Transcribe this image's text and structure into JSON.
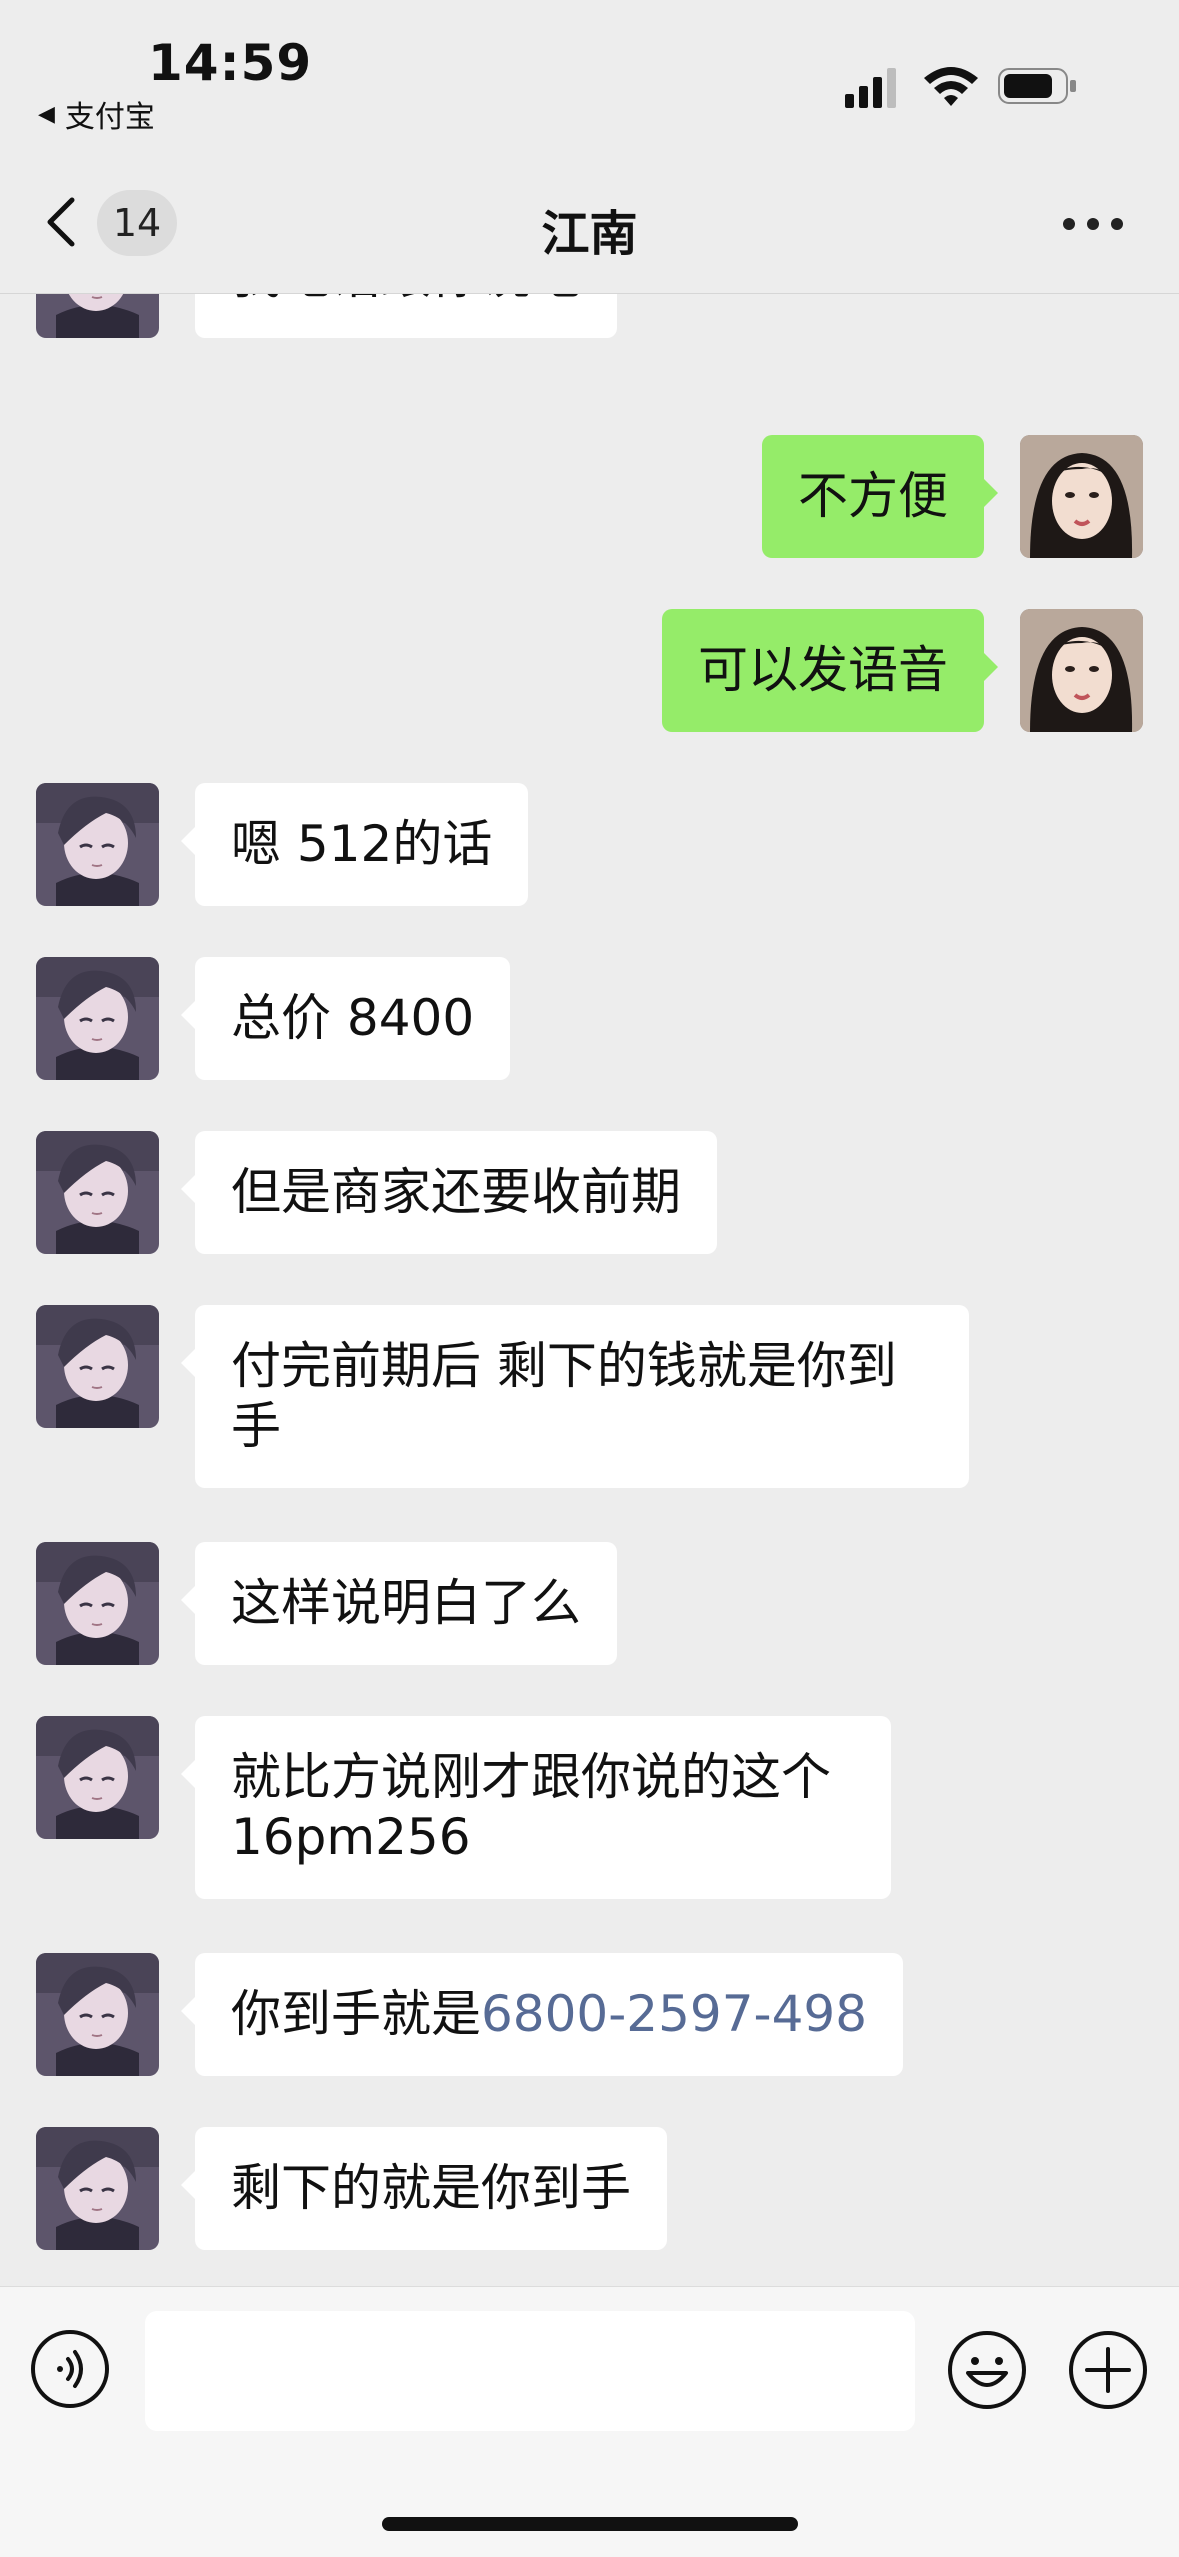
{
  "status_bar": {
    "time": "14:59",
    "back_app_label": "支付宝",
    "icons": [
      "cellular-signal-icon",
      "wifi-icon",
      "battery-icon"
    ]
  },
  "nav": {
    "title": "江南",
    "unread_count": "14",
    "icons": [
      "chevron-left-icon",
      "more-icon"
    ]
  },
  "messages": [
    {
      "side": "left",
      "text": "我电话跟你说吧"
    },
    {
      "side": "right",
      "text": "不方便"
    },
    {
      "side": "right",
      "text": "可以发语音"
    },
    {
      "side": "left",
      "text": "嗯 512的话"
    },
    {
      "side": "left",
      "text": "总价 8400"
    },
    {
      "side": "left",
      "text": "但是商家还要收前期"
    },
    {
      "side": "left",
      "text": "付完前期后  剩下的钱就是你到手"
    },
    {
      "side": "left",
      "text": "这样说明白了么"
    },
    {
      "side": "left",
      "text": "就比方说刚才跟你说的这个16pm256"
    },
    {
      "side": "left",
      "text": "你到手就是",
      "link_text": "6800-2597-498"
    },
    {
      "side": "left",
      "text": "剩下的就是你到手"
    }
  ],
  "input_bar": {
    "placeholder": "",
    "icons": [
      "voice-icon",
      "emoji-icon",
      "plus-icon"
    ]
  },
  "colors": {
    "background": "#ededed",
    "outgoing_bubble": "#95ec69",
    "incoming_bubble": "#ffffff",
    "link": "#576b95"
  }
}
